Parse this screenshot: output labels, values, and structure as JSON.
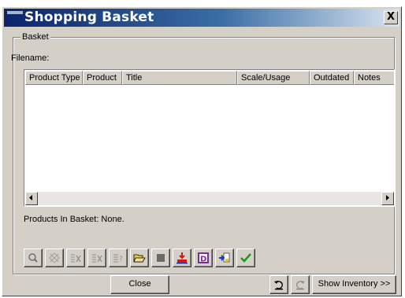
{
  "window": {
    "title": "Shopping Basket",
    "close_glyph": "X"
  },
  "basket": {
    "group_label": "Basket",
    "filename_label": "Filename:",
    "columns": [
      "Product Type",
      "Product",
      "Title",
      "Scale/Usage",
      "Outdated",
      "Notes"
    ],
    "rows": [],
    "status": "Products In Basket: None."
  },
  "toolbar": {
    "icons": [
      "magnifier-icon",
      "clear-marked-icon",
      "remove-item-icon",
      "remove-all-icon",
      "list-details-icon",
      "open-folder-icon",
      "stop-square-icon",
      "download-red-icon",
      "d-purple-icon",
      "import-arrow-icon",
      "green-check-icon"
    ]
  },
  "footer": {
    "close_label": "Close",
    "show_inventory_label": "Show Inventory >>",
    "icon_buttons": [
      "undo-arrow-icon",
      "redo-arrow-icon"
    ]
  },
  "colors": {
    "title_gradient_start": "#0a246a",
    "title_gradient_end": "#d8e4f0",
    "dialog_face": "#d4d0c8",
    "check_green": "#1a9a1a",
    "d_purple": "#7a2a9a",
    "download_red": "#d01818"
  }
}
